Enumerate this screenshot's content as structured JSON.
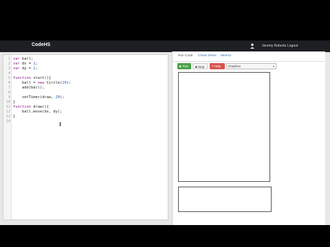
{
  "header": {
    "logo": "CodeHS",
    "user_icon": "user-icon",
    "username": "Jeremy Roberts",
    "logout": "Logout"
  },
  "editor": {
    "lines": [
      {
        "n": "1",
        "t": "var ball;"
      },
      {
        "n": "2",
        "t": "var dx = 1;"
      },
      {
        "n": "3",
        "t": "var dy = 2;"
      },
      {
        "n": "4",
        "t": ""
      },
      {
        "n": "5",
        "t": "function start(){"
      },
      {
        "n": "6",
        "t": "    ball = new Circle(20);"
      },
      {
        "n": "7",
        "t": "    add(ball);"
      },
      {
        "n": "8",
        "t": ""
      },
      {
        "n": "9",
        "t": "    setTimer(draw, 20);"
      },
      {
        "n": "10",
        "t": "}"
      },
      {
        "n": "11",
        "t": "function draw(){"
      },
      {
        "n": "12",
        "t": "    ball.move(dx, dy);"
      },
      {
        "n": "13",
        "t": "}"
      },
      {
        "n": "14",
        "t": ""
      }
    ]
  },
  "tabs": [
    {
      "label": "Run Code",
      "active": true
    },
    {
      "label": "Cheat Sheet",
      "active": false
    },
    {
      "label": "Metrics",
      "active": false
    }
  ],
  "controls": {
    "run": "▶ Run",
    "stop": "■ Stop",
    "help": "? Help",
    "mode": "Graphics"
  }
}
